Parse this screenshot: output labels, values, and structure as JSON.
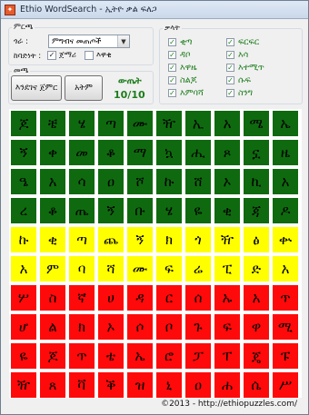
{
  "window": {
    "title": "Ethio WordSearch - ኢትዮ ቃል ፍለጋ"
  },
  "type_group": {
    "legend": "ምርጫ",
    "category_label": "ጎራ :",
    "category_value": "ምግብና መጠጦች",
    "direction_label": "ከባድነት :",
    "opt1_label": "ጀማሪ",
    "opt1_checked": "✓",
    "opt2_label": "እዋቂ",
    "opt2_checked": ""
  },
  "game_group": {
    "legend": "መጫ",
    "new_game_label": "እንደገና ጀምር",
    "print_label": "አትም",
    "score_label": "ውጤት",
    "score_value": "10/10"
  },
  "words_group": {
    "legend": "ቃላት",
    "items": [
      {
        "label": "ቂጣ",
        "check": "✓"
      },
      {
        "label": "ፍርፍር",
        "check": "✓"
      },
      {
        "label": "ዳቦ",
        "check": "✓"
      },
      {
        "label": "እሳ",
        "check": "✓"
      },
      {
        "label": "እዋዜ",
        "check": "✓"
      },
      {
        "label": "እተሚጥ",
        "check": "✓"
      },
      {
        "label": "ስልጆ",
        "check": "✓"
      },
      {
        "label": "ሱፍ",
        "check": "✓"
      },
      {
        "label": "እምባሻ",
        "check": "✓"
      },
      {
        "label": "ስንግ",
        "check": "✓"
      }
    ]
  },
  "grid": {
    "colors": {
      "green": "#0f6a0f",
      "yellow": "#ffff00",
      "red": "#ff0a0a"
    },
    "rows": [
      {
        "color": "green",
        "cells": [
          "ጆ",
          "ቼ",
          "ሄ",
          "ጣ",
          "ሙ",
          "ዥ",
          "ኢ",
          "አ",
          "ሜ",
          "ኤ"
        ]
      },
      {
        "color": "green",
        "cells": [
          "ኝ",
          "ቀ",
          "መ",
          "ቆ",
          "ማ",
          "ኳ",
          "ሒ",
          "ጾ",
          "ኗ",
          "ዜ"
        ]
      },
      {
        "color": "green",
        "cells": [
          "ዔ",
          "አ",
          "ሳ",
          "ዐ",
          "ሾ",
          "ኩ",
          "ሸ",
          "ኦ",
          "ኪ",
          "አ"
        ]
      },
      {
        "color": "green",
        "cells": [
          "ረ",
          "ቆ",
          "ጤ",
          "ኝ",
          "ቡ",
          "ሄ",
          "ዬ",
          "ቂ",
          "ጃ",
          "ዶ"
        ]
      },
      {
        "color": "yellow",
        "cells": [
          "ኩ",
          "ቂ",
          "ጣ",
          "ጨ",
          "ኝ",
          "ክ",
          "ጎ",
          "ዥ",
          "ፅ",
          "ቍ"
        ]
      },
      {
        "color": "yellow",
        "cells": [
          "አ",
          "ም",
          "ባ",
          "ሻ",
          "ሙ",
          "ፍ",
          "ሬ",
          "ፒ",
          "ድ",
          "አ"
        ]
      },
      {
        "color": "red",
        "cells": [
          "ሦ",
          "ስ",
          "ኛ",
          "ሀ",
          "ዳ",
          "ር",
          "ሰ",
          "ኡ",
          "አ",
          "ጥ"
        ]
      },
      {
        "color": "red",
        "cells": [
          "ሆ",
          "ል",
          "ክ",
          "ኦ",
          "ሶ",
          "ቦ",
          "ጉ",
          "ፍ",
          "ዋ",
          "ሚ"
        ]
      },
      {
        "color": "red",
        "cells": [
          "ዬ",
          "ጆ",
          "ጥ",
          "ቴ",
          "ኤ",
          "ሮ",
          "ፓ",
          "ፐ",
          "ጄ",
          "ፑ"
        ]
      },
      {
        "color": "red",
        "cells": [
          "ዥ",
          "ጸ",
          "ቫ",
          "ቕ",
          "ዝ",
          "ኒ",
          "ዐ",
          "ሐ",
          "ሴ",
          "ሥ"
        ]
      }
    ]
  },
  "footer": {
    "text": "©2013 - http://ethiopuzzles.com/"
  }
}
